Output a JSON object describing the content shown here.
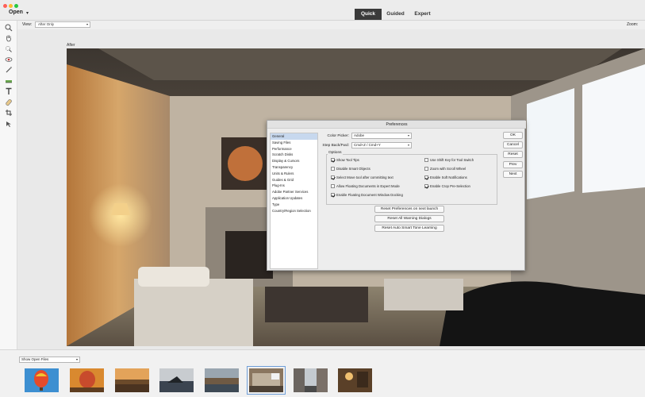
{
  "header": {
    "open_label": "Open",
    "open_caret": "▾",
    "modes": [
      {
        "label": "Quick",
        "active": true
      },
      {
        "label": "Guided",
        "active": false
      },
      {
        "label": "Expert",
        "active": false
      }
    ]
  },
  "options_bar": {
    "view_label": "View:",
    "view_value": "After Only",
    "zoom_label": "Zoom:"
  },
  "toolbar": {
    "tools": [
      "zoom-icon",
      "hand-icon",
      "quick-selection-icon",
      "red-eye-icon",
      "whiten-teeth-icon",
      "straighten-icon",
      "type-icon",
      "spot-healing-icon",
      "crop-icon",
      "move-icon"
    ]
  },
  "canvas": {
    "doc_label": "After"
  },
  "dialog": {
    "title": "Preferences",
    "categories": [
      "General",
      "Saving Files",
      "Performance",
      "Scratch Disks",
      "Display & Cursors",
      "Transparency",
      "Units & Rulers",
      "Guides & Grid",
      "Plug-Ins",
      "Adobe Partner Services",
      "Application Updates",
      "Type",
      "Country/Region Selection"
    ],
    "selected_category": "General",
    "color_picker_label": "Color Picker:",
    "color_picker_value": "Adobe",
    "step_label": "Step Back/Fwd:",
    "step_value": "Cmd+Z / Cmd+Y",
    "options_label": "Options",
    "options_left": [
      {
        "label": "Show Tool Tips",
        "checked": true
      },
      {
        "label": "Disable Smart Objects",
        "checked": false
      },
      {
        "label": "Select Move tool after committing text",
        "checked": true
      },
      {
        "label": "Allow Floating Documents in Expert Mode",
        "checked": false
      },
      {
        "label": "Enable Floating Document Window Docking",
        "checked": true
      }
    ],
    "options_right": [
      {
        "label": "Use Shift Key for Tool Switch",
        "checked": false
      },
      {
        "label": "Zoom with Scroll Wheel",
        "checked": false
      },
      {
        "label": "Enable Soft Notifications",
        "checked": true
      },
      {
        "label": "Enable Crop Pre-Selection",
        "checked": true
      }
    ],
    "reset_buttons": [
      "Reset Preferences on next launch",
      "Reset All Warning Dialogs",
      "Reset Auto Smart Tone Learning"
    ],
    "side_buttons": [
      "OK",
      "Cancel",
      "Reset",
      "Prev",
      "Next"
    ]
  },
  "bin": {
    "show_label": "Show Open Files",
    "selected_index": 5
  },
  "colors": {
    "accent_dark": "#3a3a3a",
    "selection": "#c7d8ee"
  }
}
